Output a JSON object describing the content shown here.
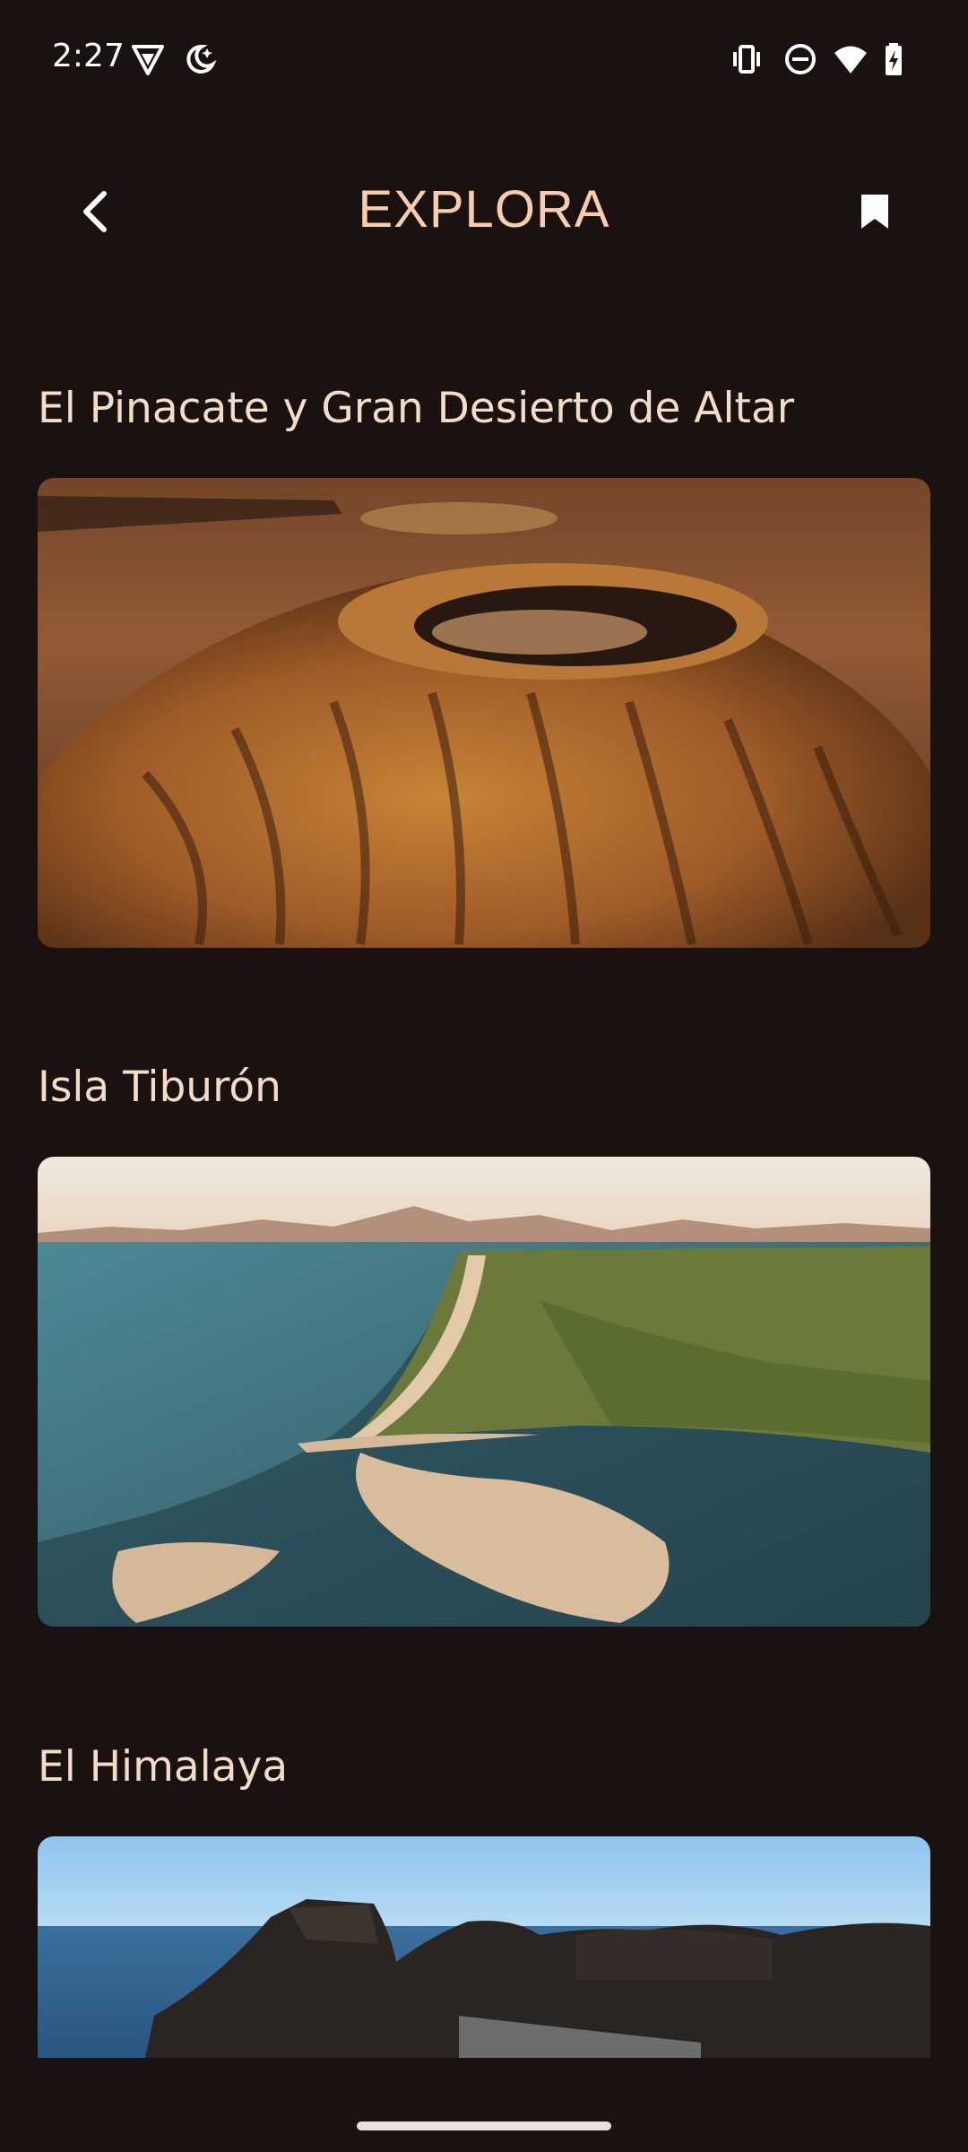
{
  "status_bar": {
    "time": "2:27",
    "icons_left": [
      "vpn-shield-icon",
      "bedtime-moon-icon"
    ],
    "icons_right": [
      "vibrate-icon",
      "do-not-disturb-icon",
      "wifi-icon",
      "battery-charging-icon"
    ]
  },
  "app_bar": {
    "title": "EXPLORA",
    "back_icon": "chevron-left-icon",
    "bookmark_icon": "bookmark-icon"
  },
  "destinations": [
    {
      "title": "El Pinacate y Gran Desierto de Altar",
      "image": "desert-crater-photo"
    },
    {
      "title": "Isla Tiburón",
      "image": "coastal-sandbar-photo"
    },
    {
      "title": "El Himalaya",
      "image": "rocky-coast-photo"
    }
  ],
  "colors": {
    "background": "#1a1210",
    "title_accent": "#f7cdab",
    "section_text": "#f3ddc8"
  }
}
